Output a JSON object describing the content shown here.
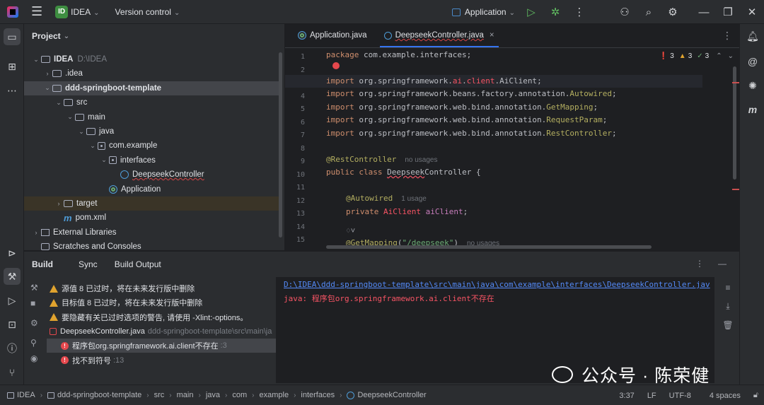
{
  "titlebar": {
    "project_badge": "ID",
    "project_name": "IDEA",
    "version_control": "Version control",
    "run_config": "Application"
  },
  "project_panel": {
    "title": "Project",
    "tree": [
      {
        "label": "IDEA",
        "note": "D:\\IDEA",
        "kind": "folder",
        "depth": 0,
        "open": true
      },
      {
        "label": ".idea",
        "kind": "folder",
        "depth": 1,
        "open": false
      },
      {
        "label": "ddd-springboot-template",
        "kind": "folder",
        "depth": 1,
        "open": true
      },
      {
        "label": "src",
        "kind": "folder",
        "depth": 2,
        "open": true
      },
      {
        "label": "main",
        "kind": "folder",
        "depth": 3,
        "open": true
      },
      {
        "label": "java",
        "kind": "folder",
        "depth": 4,
        "open": true
      },
      {
        "label": "com.example",
        "kind": "package",
        "depth": 5,
        "open": true
      },
      {
        "label": "interfaces",
        "kind": "package",
        "depth": 6,
        "open": true
      },
      {
        "label": "DeepseekController",
        "kind": "class",
        "depth": 7
      },
      {
        "label": "Application",
        "kind": "spring",
        "depth": 6
      },
      {
        "label": "target",
        "kind": "folder",
        "depth": 2,
        "open": false
      },
      {
        "label": "pom.xml",
        "kind": "maven",
        "depth": 2
      },
      {
        "label": "External Libraries",
        "kind": "library",
        "depth": 0,
        "open": false
      },
      {
        "label": "Scratches and Consoles",
        "kind": "scratch",
        "depth": 0
      }
    ]
  },
  "editor": {
    "tabs": [
      {
        "label": "Application.java",
        "active": false
      },
      {
        "label": "DeepseekController.java",
        "active": true
      }
    ],
    "inspection": {
      "errors": "3",
      "warnings": "3",
      "ok": "3"
    },
    "line_numbers": [
      "1",
      "2",
      "3",
      "4",
      "5",
      "6",
      "7",
      "8",
      "9",
      "10",
      "11",
      "12",
      "13",
      "14",
      "15"
    ],
    "hints": {
      "rest_usage": "no usages",
      "autowired_usage": "1 usage",
      "mapping_usage": "no usages"
    },
    "lines": {
      "l1_kw": "package",
      "l1_rest": " com.example.interfaces;",
      "l3_kw": "import",
      "l3_a": " org.springframework.",
      "l3_b": "ai",
      "l3_c": ".",
      "l3_d": "client",
      "l3_e": ".",
      "l3_f": "AiClient",
      "l3_g": ";",
      "l4_kw": "import",
      "l4_a": " org.springframework.beans.factory.annotation.",
      "l4_b": "Autowired",
      "l4_c": ";",
      "l5_kw": "import",
      "l5_a": " org.springframework.web.bind.annotation.",
      "l5_b": "GetMapping",
      "l5_c": ";",
      "l6_kw": "import",
      "l6_a": " org.springframework.web.bind.annotation.",
      "l6_b": "RequestParam",
      "l6_c": ";",
      "l7_kw": "import",
      "l7_a": " org.springframework.web.bind.annotation.",
      "l7_b": "RestController",
      "l7_c": ";",
      "l9_an": "@RestController",
      "l10_kw": "public class",
      "l10_a": " ",
      "l10_b": "Deepseek",
      "l10_c": "Controller",
      "l10_d": " {",
      "l12_an": "@Autowired",
      "l13_kw": "private",
      "l13_a": " ",
      "l13_b": "AiClient",
      "l13_c": " ",
      "l13_d": "aiClient",
      "l13_e": ";",
      "l14b": "♢˅",
      "l15_an": "@GetMapping",
      "l15_a": "(",
      "l15_b": "\"/deepseek\"",
      "l15_c": ")"
    }
  },
  "build_panel": {
    "title": "Build",
    "tabs": [
      "Sync",
      "Build Output"
    ],
    "items": [
      {
        "text": "源值 8 已过时，将在未来发行版中删除",
        "kind": "warning",
        "indent": 0
      },
      {
        "text": "目标值 8 已过时，将在未来发行版中删除",
        "kind": "warning",
        "indent": 0
      },
      {
        "text": "要隐藏有关已过时选项的警告, 请使用 -Xlint:-options。",
        "kind": "warning",
        "indent": 0
      },
      {
        "text": "DeepseekController.java",
        "note": "ddd-springboot-template\\src\\main\\ja",
        "kind": "file",
        "indent": 0
      },
      {
        "text": "程序包org.springframework.ai.client不存在",
        "note": ":3",
        "kind": "error",
        "indent": 1,
        "selected": true
      },
      {
        "text": "找不到符号",
        "note": ":13",
        "kind": "error",
        "indent": 1
      }
    ],
    "output": {
      "path": "D:\\IDEA\\ddd-springboot-template\\src\\main\\java\\com\\example\\interfaces\\DeepseekController.jav",
      "error": "java: 程序包org.springframework.ai.client不存在"
    }
  },
  "watermark": {
    "text": "公众号 · 陈荣健"
  },
  "statusbar": {
    "breadcrumbs": [
      "IDEA",
      "ddd-springboot-template",
      "src",
      "main",
      "java",
      "com",
      "example",
      "interfaces",
      "DeepseekController"
    ],
    "position": "3:37",
    "line_sep": "LF",
    "encoding": "UTF-8",
    "indent": "4 spaces"
  },
  "colors": {
    "accent": "#3574f0",
    "error": "#f75464",
    "warning": "#e0a32e",
    "bg": "#1e1f22",
    "panel": "#2b2d30"
  }
}
